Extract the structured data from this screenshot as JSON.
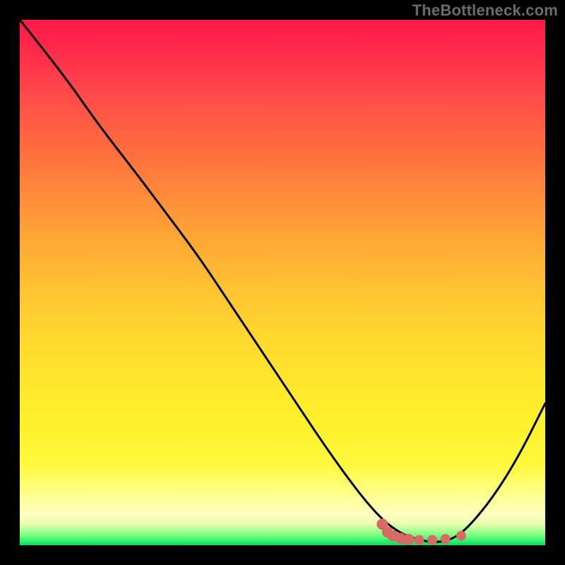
{
  "watermark": "TheBottleneck.com",
  "colors": {
    "background_frame": "#000000",
    "curve_stroke": "#000000",
    "marker_fill": "#d96a63",
    "gradient_top": "#ff1a4a",
    "gradient_bottom": "#00e060"
  },
  "chart_data": {
    "type": "line",
    "title": "",
    "xlabel": "",
    "ylabel": "",
    "xlim": [
      0,
      100
    ],
    "ylim": [
      0,
      100
    ],
    "grid": false,
    "legend": false,
    "series": [
      {
        "name": "curve",
        "x": [
          0,
          8,
          15,
          22,
          28,
          34,
          40,
          46,
          52,
          58,
          63,
          67,
          70,
          73,
          76,
          79,
          82,
          85,
          90,
          95,
          100
        ],
        "y": [
          100,
          90,
          80,
          71,
          63,
          55,
          46,
          37,
          28,
          19,
          12,
          7,
          4,
          2,
          1,
          0.5,
          1,
          3,
          9,
          17,
          27
        ]
      }
    ],
    "markers": [
      {
        "x": 69,
        "y": 4.0
      },
      {
        "x": 70,
        "y": 2.5
      },
      {
        "x": 71,
        "y": 1.8
      },
      {
        "x": 72.5,
        "y": 1.3
      },
      {
        "x": 74,
        "y": 1.1
      },
      {
        "x": 76,
        "y": 1.0
      },
      {
        "x": 78.5,
        "y": 1.0
      },
      {
        "x": 81,
        "y": 1.2
      },
      {
        "x": 84,
        "y": 1.8
      }
    ]
  }
}
